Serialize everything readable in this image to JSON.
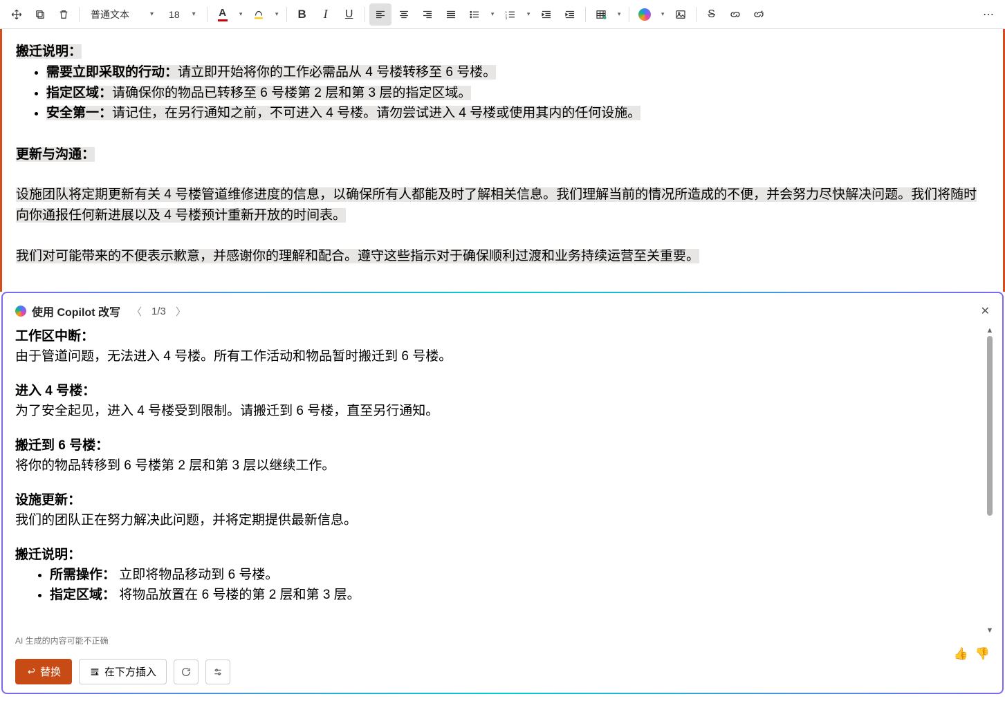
{
  "toolbar": {
    "style_select": "普通文本",
    "font_size": "18"
  },
  "document": {
    "h1": "搬迁说明：",
    "bullets": [
      {
        "b": "需要立即采取的行动：",
        "t": "请立即开始将你的工作必需品从 4 号楼转移至 6 号楼。"
      },
      {
        "b": "指定区域：",
        "t": "请确保你的物品已转移至 6 号楼第 2 层和第 3 层的指定区域。"
      },
      {
        "b": "安全第一：",
        "t": "请记住，在另行通知之前，不可进入 4 号楼。请勿尝试进入 4 号楼或使用其内的任何设施。"
      }
    ],
    "h2": "更新与沟通：",
    "p1": "设施团队将定期更新有关 4 号楼管道维修进度的信息，以确保所有人都能及时了解相关信息。我们理解当前的情况所造成的不便，并会努力尽快解决问题。我们将随时向你通报任何新进展以及 4 号楼预计重新开放的时间表。",
    "p2": "我们对可能带来的不便表示歉意，并感谢你的理解和配合。遵守这些指示对于确保顺利过渡和业务持续运营至关重要。"
  },
  "copilot": {
    "title": "使用 Copilot 改写",
    "counter": "1/3",
    "sections": [
      {
        "h": "工作区中断：",
        "p": "由于管道问题，无法进入 4 号楼。所有工作活动和物品暂时搬迁到 6 号楼。"
      },
      {
        "h": "进入 4 号楼：",
        "p": "为了安全起见，进入 4 号楼受到限制。请搬迁到 6 号楼，直至另行通知。"
      },
      {
        "h": "搬迁到 6 号楼：",
        "p": "将你的物品转移到 6 号楼第 2 层和第 3 层以继续工作。"
      },
      {
        "h": "设施更新：",
        "p": "我们的团队正在努力解决此问题，并将定期提供最新信息。"
      }
    ],
    "list_h": "搬迁说明：",
    "list": [
      {
        "b": "所需操作：",
        "t": "立即将物品移动到 6 号楼。"
      },
      {
        "b": "指定区域：",
        "t": "将物品放置在 6 号楼的第 2 层和第 3 层。"
      }
    ],
    "disclaimer": "AI 生成的内容可能不正确",
    "replace": "替换",
    "insert_below": "在下方插入"
  }
}
